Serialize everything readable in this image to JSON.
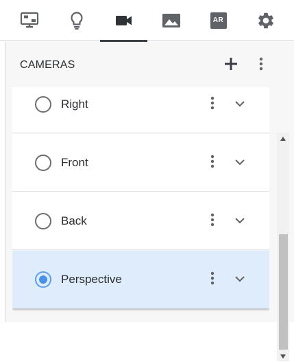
{
  "toolbar": {
    "tabs": [
      {
        "icon": "display-settings-icon",
        "active": false
      },
      {
        "icon": "light-bulb-icon",
        "active": false
      },
      {
        "icon": "video-camera-icon",
        "active": true
      },
      {
        "icon": "image-icon",
        "active": false
      },
      {
        "icon": "ar-icon",
        "active": false,
        "label": "AR"
      },
      {
        "icon": "gear-icon",
        "active": false
      }
    ]
  },
  "panel": {
    "title": "CAMERAS",
    "add_icon": "plus-icon",
    "more_icon": "more-vertical-icon"
  },
  "cameras": [
    {
      "label": "Right",
      "selected": false
    },
    {
      "label": "Front",
      "selected": false
    },
    {
      "label": "Back",
      "selected": false
    },
    {
      "label": "Perspective",
      "selected": true
    }
  ],
  "colors": {
    "selected_row": "#dfecfb",
    "radio_selected": "#4a90ea",
    "icon": "#5f6368",
    "active_tab_indicator": "#3b3f45"
  }
}
